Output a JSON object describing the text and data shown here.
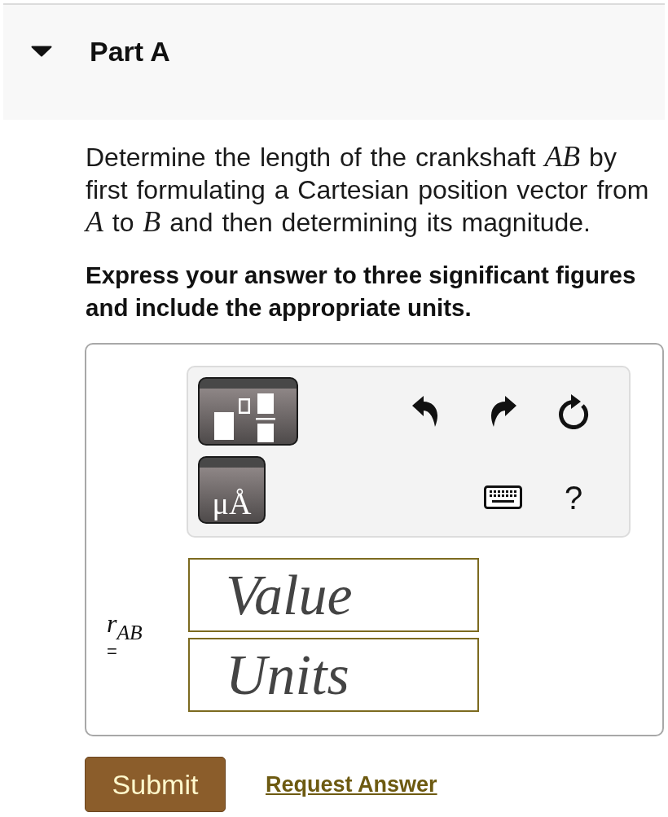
{
  "part": {
    "title": "Part A",
    "expanded": true
  },
  "question": "Determine the length of the crankshaft *AB* by first formulating a Cartesian position vector from *A* to *B* and then determining its magnitude.",
  "instruction": "Express your answer to three significant figures and include the appropriate units.",
  "toolbar": {
    "templates": [
      {
        "kind": "fraction-exponent"
      },
      {
        "kind": "units",
        "label": "μÅ"
      }
    ],
    "tools": [
      {
        "kind": "undo"
      },
      {
        "kind": "redo"
      },
      {
        "kind": "reset"
      },
      {
        "kind": "keyboard"
      },
      {
        "kind": "help",
        "label": "?"
      }
    ]
  },
  "answer": {
    "label": "r$_{AB}$",
    "equals": "=",
    "fields": [
      {
        "placeholder": "Value"
      },
      {
        "placeholder": "Units"
      }
    ]
  },
  "actions": [
    {
      "kind": "submit",
      "label": "Submit"
    },
    {
      "kind": "link",
      "label": "Request Answer"
    }
  ]
}
